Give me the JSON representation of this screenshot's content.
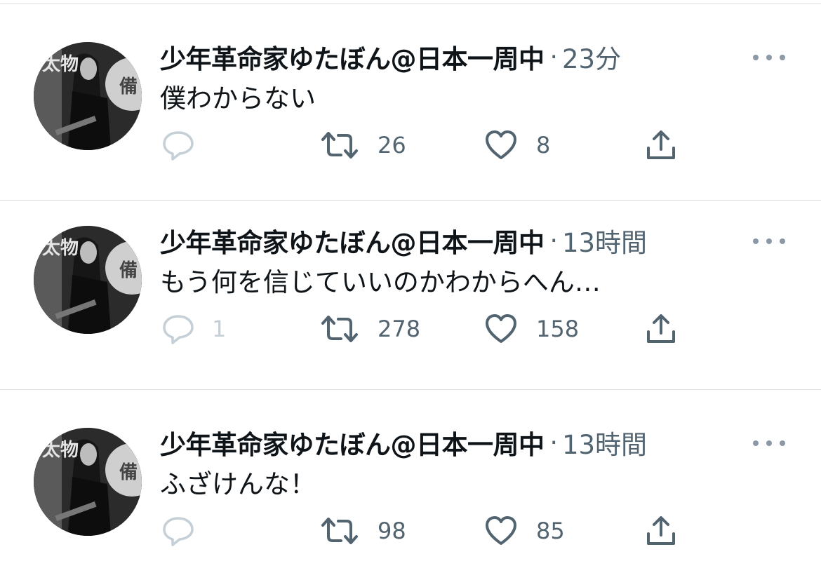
{
  "tweets": [
    {
      "author": "少年革命家ゆたぼん@日本一周中",
      "separator": "·",
      "time": "23分",
      "text": "僕わからない",
      "replies": "",
      "retweets": "26",
      "likes": "8"
    },
    {
      "author": "少年革命家ゆたぼん@日本一周中",
      "separator": "·",
      "time": "13時間",
      "text": "もう何を信じていいのかわからへん…",
      "replies": "1",
      "retweets": "278",
      "likes": "158"
    },
    {
      "author": "少年革命家ゆたぼん@日本一周中",
      "separator": "·",
      "time": "13時間",
      "text": "ふざけんな！",
      "replies": "",
      "retweets": "98",
      "likes": "85"
    }
  ],
  "avatar_sign": {
    "left_chars": "太物",
    "right_char": "備"
  },
  "icons": [
    "reply-icon",
    "retweet-icon",
    "like-icon",
    "share-icon",
    "more-icon"
  ],
  "colors": {
    "text_primary": "#0f1419",
    "text_secondary": "#536471",
    "reply_faint": "#c4cfd6",
    "divider": "#dadde1"
  }
}
